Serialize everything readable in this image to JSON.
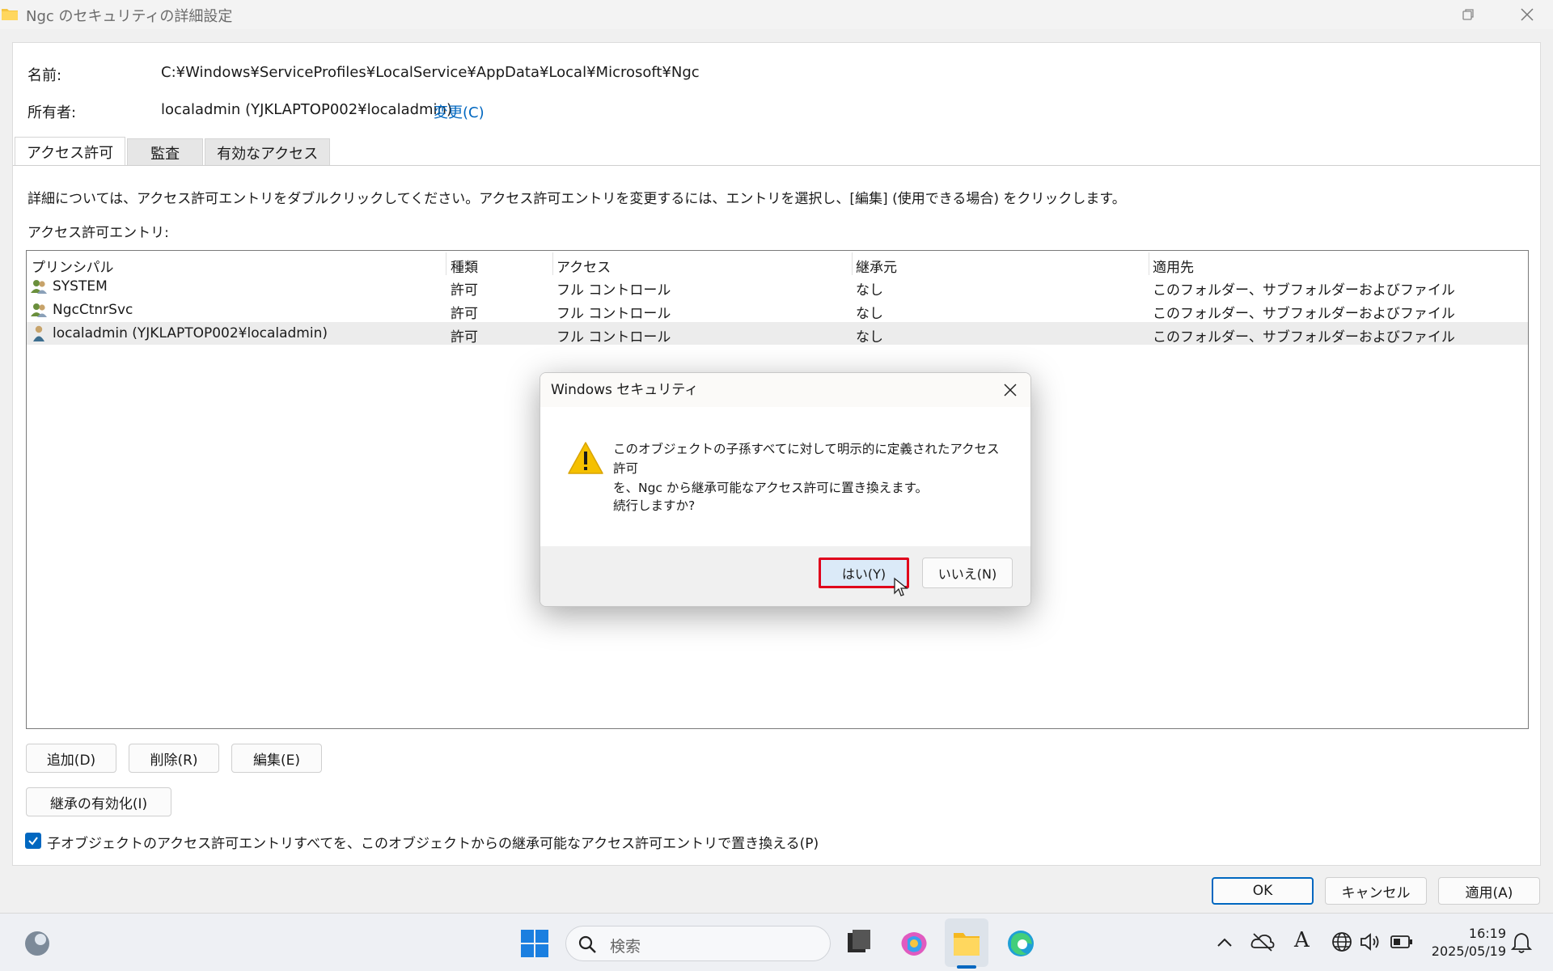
{
  "window": {
    "title": "Ngc のセキュリティの詳細設定",
    "restore_icon": "restore-icon",
    "close_icon": "close-icon"
  },
  "info": {
    "name_label": "名前:",
    "name_value": "C:¥Windows¥ServiceProfiles¥LocalService¥AppData¥Local¥Microsoft¥Ngc",
    "owner_label": "所有者:",
    "owner_value": "localadmin (YJKLAPTOP002¥localadmin)",
    "owner_change": "変更(C)"
  },
  "tabs": [
    "アクセス許可",
    "監査",
    "有効なアクセス"
  ],
  "description": "詳細については、アクセス許可エントリをダブルクリックしてください。アクセス許可エントリを変更するには、エントリを選択し、[編集] (使用できる場合) をクリックします。",
  "entries_label": "アクセス許可エントリ:",
  "table": {
    "headers": [
      "プリンシパル",
      "種類",
      "アクセス",
      "継承元",
      "適用先"
    ],
    "rows": [
      {
        "principal": "SYSTEM",
        "type": "許可",
        "access": "フル コントロール",
        "inherited": "なし",
        "applies": "このフォルダー、サブフォルダーおよびファイル",
        "icon": "group-icon"
      },
      {
        "principal": "NgcCtnrSvc",
        "type": "許可",
        "access": "フル コントロール",
        "inherited": "なし",
        "applies": "このフォルダー、サブフォルダーおよびファイル",
        "icon": "group-icon"
      },
      {
        "principal": "localadmin (YJKLAPTOP002¥localadmin)",
        "type": "許可",
        "access": "フル コントロール",
        "inherited": "なし",
        "applies": "このフォルダー、サブフォルダーおよびファイル",
        "icon": "user-icon"
      }
    ]
  },
  "buttons": {
    "add": "追加(D)",
    "remove": "削除(R)",
    "edit": "編集(E)",
    "enable_inheritance": "継承の有効化(I)",
    "ok": "OK",
    "cancel": "キャンセル",
    "apply": "適用(A)"
  },
  "replace_checkbox": {
    "label": "子オブジェクトのアクセス許可エントリすべてを、このオブジェクトからの継承可能なアクセス許可エントリで置き換える(P)",
    "checked": true
  },
  "dialog": {
    "title": "Windows セキュリティ",
    "message_line1": "このオブジェクトの子孫すべてに対して明示的に定義されたアクセス許可",
    "message_line2": "を、Ngc から継承可能なアクセス許可に置き換えます。",
    "question": "続行しますか?",
    "yes": "はい(Y)",
    "no": "いいえ(N)",
    "icon": "warning-icon",
    "highlight_color": "#e0001b"
  },
  "taskbar": {
    "search_placeholder": "検索",
    "time": "16:19",
    "date": "2025/05/19"
  }
}
